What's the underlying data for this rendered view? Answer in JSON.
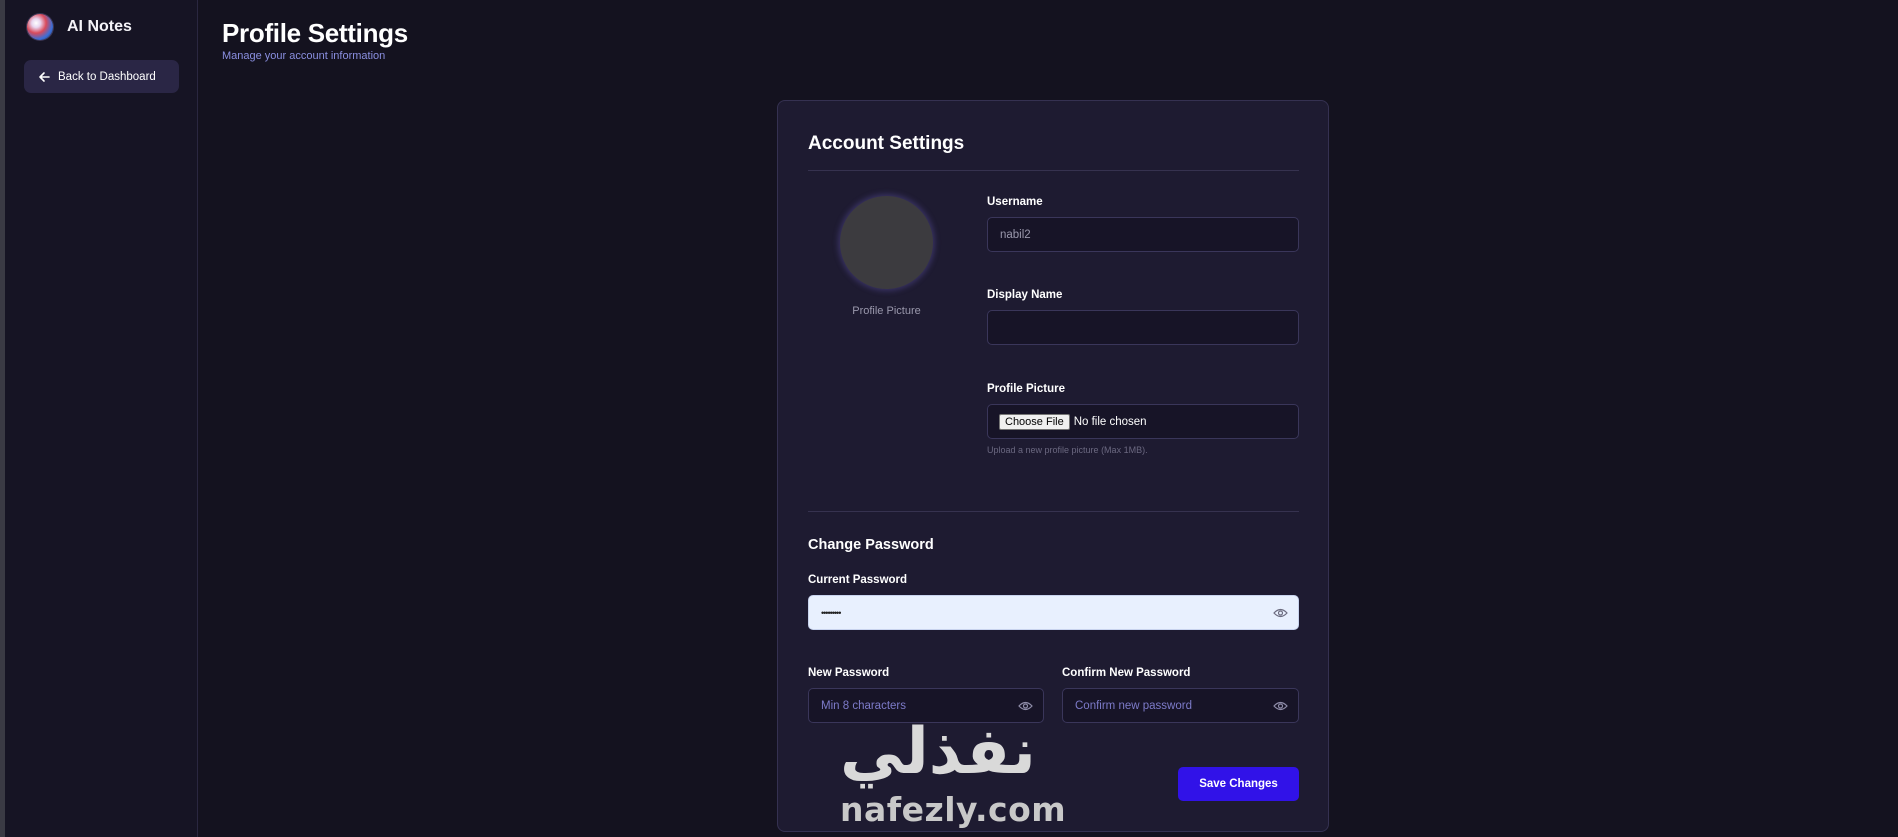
{
  "app": {
    "title": "AI Notes"
  },
  "sidebar": {
    "back_label": "Back to Dashboard"
  },
  "header": {
    "title": "Profile Settings",
    "subtitle": "Manage your account information"
  },
  "card": {
    "title": "Account Settings",
    "avatar_caption": "Profile Picture",
    "username": {
      "label": "Username",
      "value": "nabil2"
    },
    "display_name": {
      "label": "Display Name",
      "value": ""
    },
    "profile_picture": {
      "label": "Profile Picture",
      "button_label": "Choose File",
      "status": "No file chosen",
      "hint": "Upload a new profile picture (Max 1MB)."
    },
    "password_section": {
      "title": "Change Password",
      "current": {
        "label": "Current Password",
        "value": "•••••••••"
      },
      "new": {
        "label": "New Password",
        "placeholder": "Min 8 characters"
      },
      "confirm": {
        "label": "Confirm New Password",
        "placeholder": "Confirm new password"
      }
    },
    "save_label": "Save Changes"
  },
  "watermark": {
    "arabic": "نفذلي",
    "latin": "nafezly.com"
  }
}
